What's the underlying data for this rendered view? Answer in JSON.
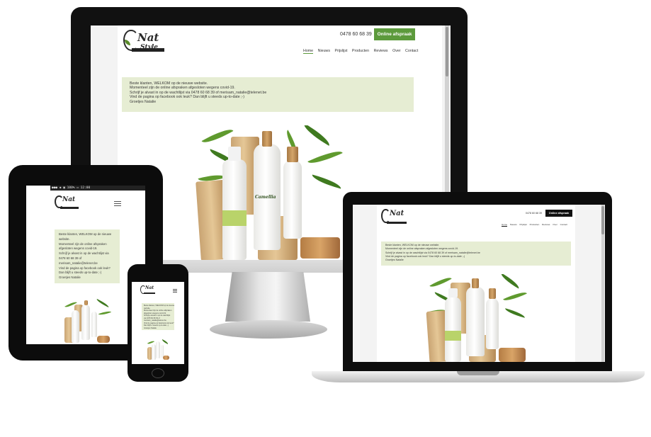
{
  "desktop": {
    "logo_text": "Nat",
    "logo_sub": "Style",
    "phone": "0478 60 68 39",
    "cta": "Online afspraak",
    "nav": [
      "Home",
      "Nieuws",
      "Prijslijst",
      "Producten",
      "Reviews",
      "Over",
      "Contact"
    ],
    "notice": [
      "Beste klanten, WELKOM op de nieuwe website.",
      "Momenteel zijn de online afspraken afgesloten wegens covid-19.",
      "Schrijf je alvast in op de wachtlijst via 0478 60 68 39 of merisam_natalie@telenet.be",
      "Vind de pagina op facebook ook leuk? Dan blijft u steeds up-to-date ;-)",
      "Groetjes Natalie"
    ],
    "bottle_label": "Camellia"
  },
  "tablet": {
    "status": "●●● ◆ ▣ 100% ▭ 12:00",
    "notice": [
      "Beste klanten, WELKOM op de nieuwe",
      "website.",
      "Momenteel zijn de online afspraken",
      "afgesloten wegens covid-19.",
      "Schrijf je alvast in op de wachtlijst via",
      "0478 60 68 39 of",
      "merisam_natalie@telenet.be",
      "Vind de pagina op facebook ook leuk?",
      "Dan blijft u steeds up-to-date ;-)",
      "Groetjes Natalie"
    ]
  },
  "phone": {
    "notice": [
      "Beste klanten, WELKOM op de nieuwe",
      "website.",
      "Momenteel zijn de online afspraken",
      "afgesloten wegens covid-19.",
      "Schrijf je alvast in op de wachtlijst",
      "via 0478 60 68 39 of",
      "merisam_natalie@telenet.be",
      "Vind de pagina op facebook ook leuk?",
      "Dan blijft u steeds up-to-date ;-)",
      "Groetjes Natalie"
    ]
  },
  "laptop": {
    "phone": "0478 60 68 39",
    "cta": "Online afspraak",
    "nav": [
      "Home",
      "Nieuws",
      "Prijslijst",
      "Producten",
      "Reviews",
      "Over",
      "Contact"
    ],
    "notice": [
      "Beste klanten, WELKOM op de nieuwe website.",
      "Momenteel zijn de online afspraken afgesloten wegens covid-19.",
      "Schrijf je alvast in op de wachtlijst via 0478 60 68 39 of merisam_natalie@telenet.be",
      "Vind de pagina op facebook ook leuk? Dan blijft u steeds up-to-date ;-)",
      "Groetjes Natalie"
    ]
  },
  "colors": {
    "cta_green": "#5c9a3c",
    "cta_black": "#111111",
    "notice_bg": "#e6edd3"
  }
}
